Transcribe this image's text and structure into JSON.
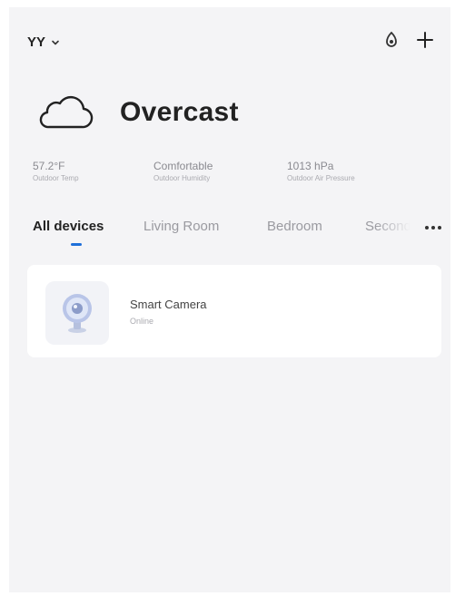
{
  "header": {
    "home_name": "YY",
    "icons": [
      "chevron-down-icon",
      "voice-assistant-icon",
      "add-icon"
    ]
  },
  "weather": {
    "icon": "cloud-icon",
    "condition": "Overcast",
    "stats": [
      {
        "value": "57.2°F",
        "label": "Outdoor Temp"
      },
      {
        "value": "Comfortable",
        "label": "Outdoor Humidity"
      },
      {
        "value": "1013 hPa",
        "label": "Outdoor Air Pressure"
      }
    ]
  },
  "tabs": [
    {
      "label": "All devices",
      "active": true
    },
    {
      "label": "Living Room",
      "active": false
    },
    {
      "label": "Bedroom",
      "active": false
    },
    {
      "label": "Second",
      "active": false
    }
  ],
  "devices": [
    {
      "name": "Smart Camera",
      "status": "Online",
      "icon": "smart-camera-icon"
    }
  ],
  "colors": {
    "background": "#f4f4f6",
    "card": "#ffffff",
    "accent": "#1e6fd9",
    "text_primary": "#222222",
    "text_secondary": "#9a9aa0"
  }
}
